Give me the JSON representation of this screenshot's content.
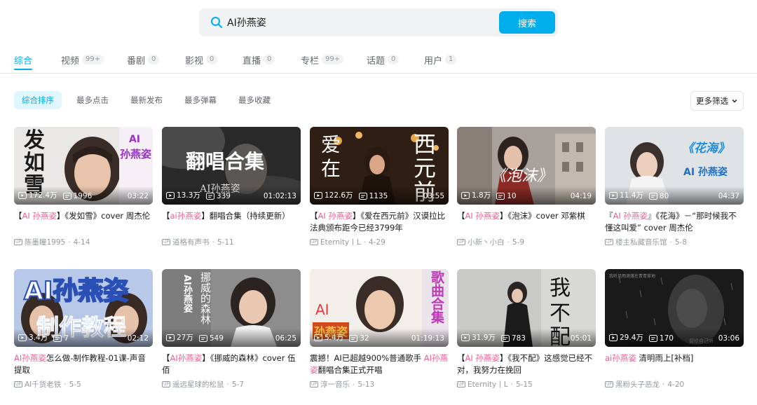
{
  "search": {
    "value": "AI孙燕姿",
    "button": "搜索"
  },
  "tabs": [
    {
      "label": "综合",
      "count": ""
    },
    {
      "label": "视频",
      "count": "99+"
    },
    {
      "label": "番剧",
      "count": "0"
    },
    {
      "label": "影视",
      "count": "0"
    },
    {
      "label": "直播",
      "count": "0"
    },
    {
      "label": "专栏",
      "count": "99+"
    },
    {
      "label": "话题",
      "count": "0"
    },
    {
      "label": "用户",
      "count": "1"
    }
  ],
  "sort": [
    "综合排序",
    "最多点击",
    "最新发布",
    "最多弹幕",
    "最多收藏"
  ],
  "more_filter": "更多筛选",
  "colors": {
    "accent": "#00aeec",
    "highlight": "#f25d8e"
  },
  "cards": [
    {
      "plays": "172.4万",
      "danmaku": "1996",
      "duration": "03:22",
      "title_pre": "【",
      "title_hl": "AI 孙燕姿",
      "title_post": "】《发如雪》cover 周杰伦",
      "author": "陈墨瞳1995",
      "date": "4-14",
      "thumb_text": {
        "a": "发",
        "b": "如",
        "c": "雪",
        "d": "AI",
        "e": "孙燕姿"
      }
    },
    {
      "plays": "13.3万",
      "danmaku": "339",
      "duration": "01:02:13",
      "title_pre": "【",
      "title_hl": "ai孙燕姿",
      "title_post": "】翻唱合集（持续更新）",
      "author": "道格有声书",
      "date": "5-11",
      "thumb_text": {
        "a": "翻唱合集",
        "b": "AI孙燕姿"
      }
    },
    {
      "plays": "122.6万",
      "danmaku": "1135",
      "duration": "03:55",
      "title_pre": "【",
      "title_hl": "AI 孙燕姿",
      "title_post": "】《爱在西元前》汉谟拉比法典颁布距今已经3799年",
      "author": "Eternity丨L",
      "date": "4-29",
      "thumb_text": {
        "a": "爱",
        "b": "在",
        "c": "西",
        "d": "元",
        "e": "前"
      }
    },
    {
      "plays": "1.8万",
      "danmaku": "10",
      "duration": "04:19",
      "title_pre": "【",
      "title_hl": "AI 孙燕姿",
      "title_post": "】《泡沫》cover 邓紫棋",
      "author": "小新丶小白",
      "date": "5-9",
      "thumb_text": {
        "a": "《泡沫》"
      }
    },
    {
      "plays": "11.4万",
      "danmaku": "80",
      "duration": "04:37",
      "title_pre": "『",
      "title_hl": "AI 孙燕姿",
      "title_post": "』《花海》－“那时候我不懂这叫爱” cover 周杰伦",
      "author": "楼主私藏音乐馆",
      "date": "5-8",
      "thumb_text": {
        "a": "《花海》",
        "b": "AI 孙燕姿"
      }
    },
    {
      "plays": "3.4万",
      "danmaku": "7",
      "duration": "02:12",
      "title_pre": "",
      "title_hl": "AI孙燕姿",
      "title_post": "怎么做-制作教程-01课-声音提取",
      "author": "AI千货老铁",
      "date": "5-5",
      "thumb_text": {
        "a": "AI孙燕姿",
        "b": "制作教程"
      }
    },
    {
      "plays": "27万",
      "danmaku": "549",
      "duration": "06:25",
      "title_pre": "【",
      "title_hl": "AI孙燕姿",
      "title_post": "】《挪威的森林》cover 伍佰",
      "author": "遥远星球的松鼠",
      "date": "5-7",
      "thumb_text": {
        "a": "AI孙燕姿",
        "b": "挪威的森林"
      }
    },
    {
      "plays": "5.4万",
      "danmaku": "32",
      "duration": "01:19:13",
      "title_pre": "震撼！AI已超越900%普通歌手 ",
      "title_hl": "AI孙燕姿",
      "title_post": "翻唱合集正式开唱",
      "author": "淳一音乐",
      "date": "5-13",
      "thumb_text": {
        "a": "AI",
        "b": "孙燕姿",
        "c": "歌曲合集"
      }
    },
    {
      "plays": "31.9万",
      "danmaku": "783",
      "duration": "05:01",
      "title_pre": "【",
      "title_hl": "AI 孙燕姿",
      "title_post": "】《我不配》这感觉已经不对，我努力在挽回",
      "author": "Eternity丨L",
      "date": "5-15",
      "thumb_text": {
        "a": "我",
        "b": "不",
        "c": "配"
      }
    },
    {
      "plays": "29.4万",
      "danmaku": "170",
      "duration": "03:06",
      "title_pre": "",
      "title_hl": "ai孙燕姿",
      "title_post": " 清明雨上[补档]",
      "author": "黑粉头子恶龙",
      "date": "4-20",
      "thumb_text": {
        "a": "我听见雨滴落在青青草地",
        "b": "留给自己听"
      }
    }
  ]
}
